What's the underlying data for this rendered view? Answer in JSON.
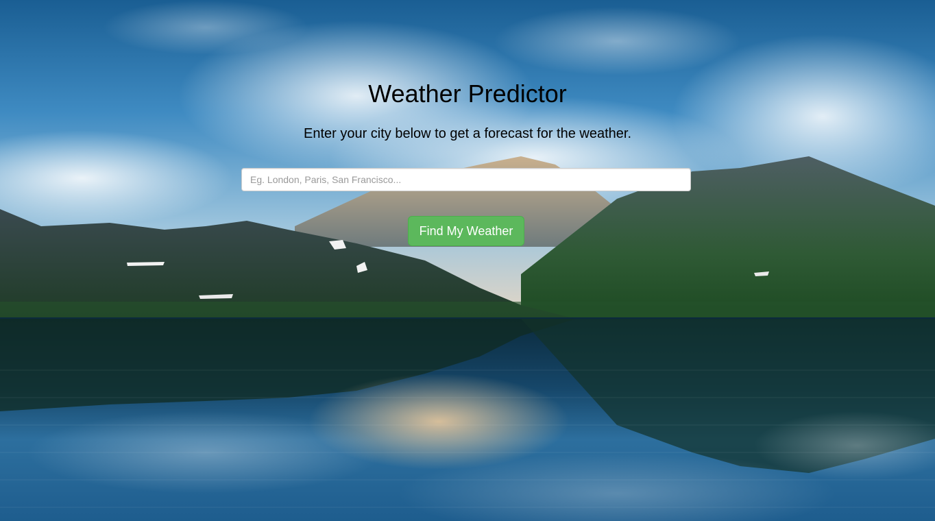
{
  "hero": {
    "title": "Weather Predictor",
    "subtitle": "Enter your city below to get a forecast for the weather."
  },
  "search": {
    "value": "",
    "placeholder": "Eg. London, Paris, San Francisco...",
    "button_label": "Find My Weather"
  },
  "colors": {
    "button_bg": "#5cb85c",
    "button_border": "#4cae4c",
    "sky_top": "#1e6fa8",
    "water_mid": "#13425f"
  },
  "background": {
    "scene": "mountain-lake-icon"
  }
}
